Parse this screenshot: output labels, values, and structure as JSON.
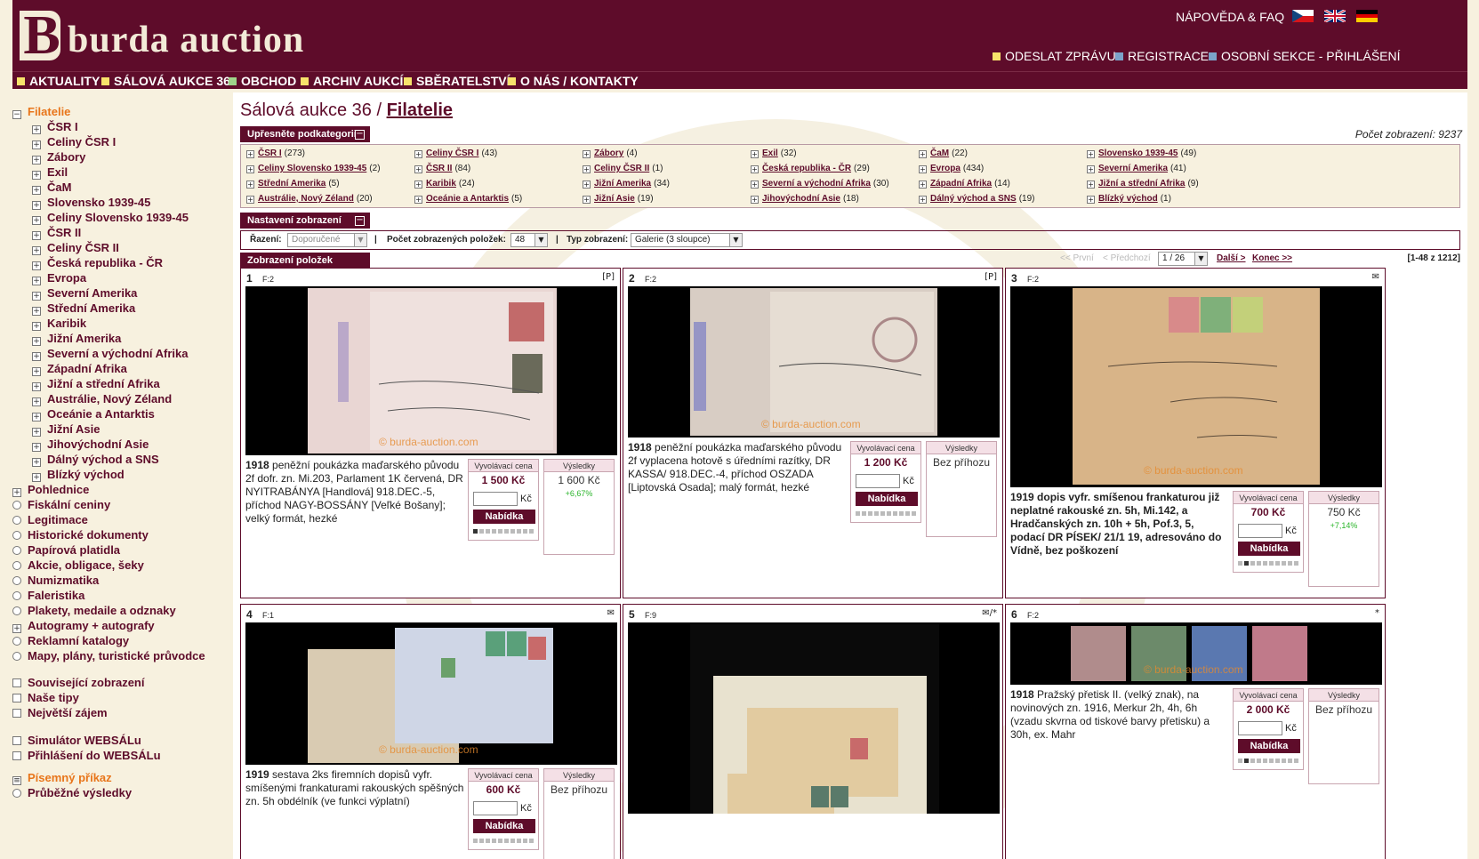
{
  "header": {
    "logo_mark": "B",
    "logo_text": "burda auction",
    "help": "NÁPOVĚDA & FAQ",
    "send_message": "ODESLAT ZPRÁVU",
    "register": "REGISTRACE",
    "personal": "OSOBNÍ SEKCE - PŘIHLÁŠENÍ",
    "colors": {
      "brand": "#5e0c2a",
      "background": "#f7f1df",
      "square_yellow": "#f7e36b",
      "square_blue": "#7ba3c9"
    }
  },
  "nav": [
    "AKTUALITY",
    "SÁLOVÁ AUKCE 36",
    "OBCHOD",
    "ARCHIV AUKCÍ",
    "SBĚRATELSTVÍ",
    "O NÁS / KONTAKTY"
  ],
  "sidebar": {
    "active": "Filatelie",
    "sub": [
      "ČSR I",
      "Celiny ČSR I",
      "Zábory",
      "Exil",
      "ČaM",
      "Slovensko 1939-45",
      "Celiny Slovensko 1939-45",
      "ČSR II",
      "Celiny ČSR II",
      "Česká republika - ČR",
      "Evropa",
      "Severní Amerika",
      "Střední Amerika",
      "Karibik",
      "Jižní Amerika",
      "Severní a východní Afrika",
      "Západní Afrika",
      "Jižní a střední Afrika",
      "Austrálie, Nový Zéland",
      "Oceánie a Antarktis",
      "Jižní Asie",
      "Jihovýchodní Asie",
      "Dálný východ a SNS",
      "Blízký východ"
    ],
    "top": [
      "Pohlednice",
      "Fiskální ceniny",
      "Legitimace",
      "Historické dokumenty",
      "Papírová platidla",
      "Akcie, obligace, šeky",
      "Numizmatika",
      "Faleristika",
      "Plakety, medaile a odznaky",
      "Autogramy + autografy",
      "Reklamní katalogy",
      "Mapy, plány, turistické průvodce"
    ],
    "extra1": [
      "Související zobrazení",
      "Naše tipy",
      "Největší zájem"
    ],
    "extra2": [
      "Simulátor WEBSÁLu",
      "Přihlášení do WEBSÁLu"
    ],
    "order": "Písemný příkaz",
    "results": "Průběžné výsledky"
  },
  "main": {
    "title_prefix": "Sálová aukce 36 / ",
    "title_link": "Filatelie",
    "views_label": "Počet zobrazení: 9237",
    "subcat_header": "Upřesněte podkategorii",
    "subcats": [
      [
        "ČSR I",
        "(273)",
        "Celiny ČSR I",
        "(43)",
        "Zábory",
        "(4)",
        "Exil",
        "(32)",
        "ČaM",
        "(22)",
        "Slovensko 1939-45",
        "(49)"
      ],
      [
        "Celiny Slovensko 1939-45",
        "(2)",
        "ČSR II",
        "(84)",
        "Celiny ČSR II",
        "(1)",
        "Česká republika - ČR",
        "(29)",
        "Evropa",
        "(434)",
        "Severní Amerika",
        "(41)"
      ],
      [
        "Střední Amerika",
        "(5)",
        "Karibik",
        "(24)",
        "Jižní Amerika",
        "(34)",
        "Severní a východní Afrika",
        "(30)",
        "Západní Afrika",
        "(14)",
        "Jižní a střední Afrika",
        "(9)"
      ],
      [
        "Austrálie, Nový Zéland",
        "(20)",
        "Oceánie a Antarktis",
        "(5)",
        "Jižní Asie",
        "(19)",
        "Jihovýchodní Asie",
        "(18)",
        "Dálný východ a SNS",
        "(19)",
        "Blízký východ",
        "(1)"
      ]
    ],
    "settings_header": "Nastavení zobrazení",
    "sort_label": "Řazení:",
    "sort_value": "Doporučené",
    "count_label": "Počet zobrazených položek:",
    "count_value": "48",
    "type_label": "Typ zobrazení:",
    "type_value": "Galerie (3 sloupce)",
    "items_header": "Zobrazení položek",
    "pager": {
      "first": "<< První",
      "prev": "< Předchozí",
      "page": "1 / 26",
      "next": "Další >",
      "last": "Konec >>",
      "range": "[1-48 z 1212]"
    },
    "watermark": "© burda-auction.com",
    "start_label": "Vyvolávací cena",
    "result_label": "Výsledky",
    "kc": "Kč",
    "bid": "Nabídka",
    "lots": [
      {
        "num": "1",
        "f": "F:2",
        "icon": "[P]",
        "year": "1918",
        "desc": " peněžní poukázka maďarského původu 2f dofr. zn. Mi.203, Parlament 1K červená, DR NYITRABÁNYA [Handlová] 918.DEC.-5, příchod NAGY-BOSSÁNY [Veľké Bošany]; velký formát, hezké",
        "price": "1 500 Kč",
        "result": "1 600 Kč",
        "pct": "+6,67%",
        "dot": 0
      },
      {
        "num": "2",
        "f": "F:2",
        "icon": "[P]",
        "year": "1918",
        "desc": " peněžní poukázka maďarského původu 2f vyplacena hotově s úředními razítky, DR KASSA/ 918.DEC.-4, příchod OSZADA [Liptovská Osada]; malý formát, hezké",
        "price": "1 200 Kč",
        "result": "Bez příhozu",
        "pct": "",
        "dot": -1
      },
      {
        "num": "3",
        "f": "F:2",
        "icon": "✉",
        "year": "1919",
        "desc": " dopis vyfr. smíšenou frankaturou již neplatné rakouské zn. 5h, Mi.142, a Hradčanských zn. 10h + 5h, Pof.3, 5, podací DR PÍSEK/ 21/1 19, adresováno do Vídně, bez poškození",
        "price": "700 Kč",
        "result": "750 Kč",
        "pct": "+7,14%",
        "dot": 1
      },
      {
        "num": "4",
        "f": "F:1",
        "icon": "✉",
        "year": "1919",
        "desc": " sestava 2ks firemních dopisů vyfr. smíšenými frankaturami rakouských spěšných zn. 5h obdélník (ve funkci výplatní)",
        "price": "600 Kč",
        "result": "Bez příhozu",
        "pct": "",
        "dot": -1
      },
      {
        "num": "5",
        "f": "F:9",
        "icon": "✉/*",
        "year": "",
        "desc": "",
        "price": "",
        "result": "",
        "pct": "",
        "dot": -1
      },
      {
        "num": "6",
        "f": "F:2",
        "icon": "*",
        "year": "1918",
        "desc": " Pražský přetisk II. (velký znak), na novinových zn. 1916, Merkur 2h, 4h, 6h (vzadu skvrna od tiskové barvy přetisku) a 30h, ex. Mahr",
        "price": "2 000 Kč",
        "result": "Bez příhozu",
        "pct": "",
        "dot": 1
      }
    ]
  }
}
